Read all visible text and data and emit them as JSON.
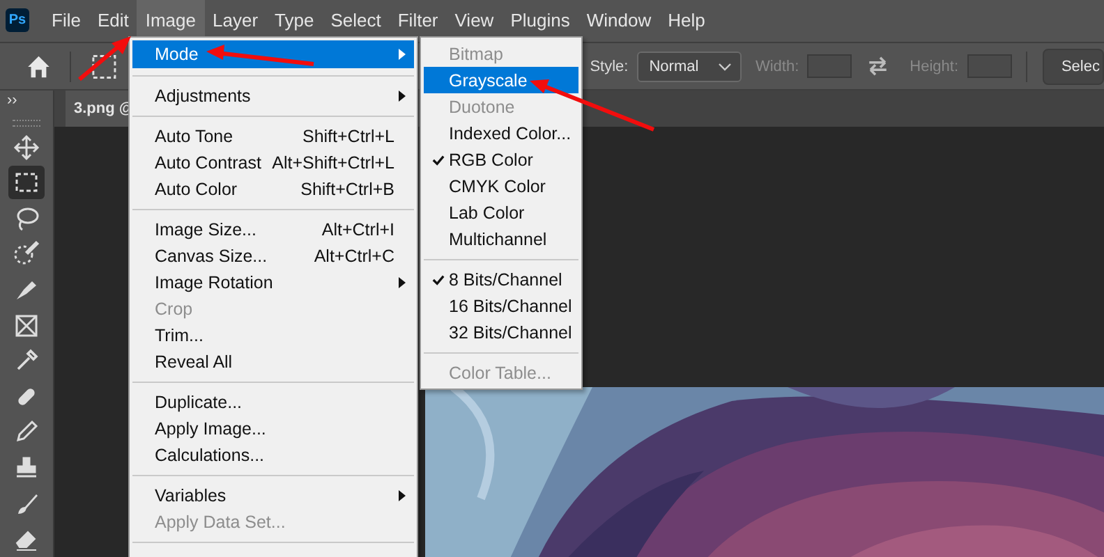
{
  "app_logo": "Ps",
  "menu_bar": [
    {
      "label": "File",
      "selected": false
    },
    {
      "label": "Edit",
      "selected": false
    },
    {
      "label": "Image",
      "selected": true
    },
    {
      "label": "Layer",
      "selected": false
    },
    {
      "label": "Type",
      "selected": false
    },
    {
      "label": "Select",
      "selected": false
    },
    {
      "label": "Filter",
      "selected": false
    },
    {
      "label": "View",
      "selected": false
    },
    {
      "label": "Plugins",
      "selected": false
    },
    {
      "label": "Window",
      "selected": false
    },
    {
      "label": "Help",
      "selected": false
    }
  ],
  "options_bar": {
    "style_label": "Style:",
    "style_value": "Normal",
    "width_label": "Width:",
    "height_label": "Height:",
    "width_disabled": true,
    "height_disabled": true,
    "button": "Selec"
  },
  "toolbar_toggle": "››",
  "tools": [
    {
      "kind": "move",
      "selected": false
    },
    {
      "kind": "marquee",
      "selected": true
    },
    {
      "kind": "lasso",
      "selected": false
    },
    {
      "kind": "quick-select",
      "selected": false
    },
    {
      "kind": "pen",
      "selected": false
    },
    {
      "kind": "frame",
      "selected": false
    },
    {
      "kind": "eyedropper",
      "selected": false
    },
    {
      "kind": "healing",
      "selected": false
    },
    {
      "kind": "pencil",
      "selected": false
    },
    {
      "kind": "stamp",
      "selected": false
    },
    {
      "kind": "brush",
      "selected": false
    },
    {
      "kind": "eraser",
      "selected": false
    }
  ],
  "document_tab": "3.png @",
  "image_menu": [
    {
      "kind": "item",
      "label": "Mode",
      "submenu": true,
      "selected": true,
      "disabled": false
    },
    {
      "kind": "separator"
    },
    {
      "kind": "item",
      "label": "Adjustments",
      "submenu": true,
      "selected": false,
      "disabled": false
    },
    {
      "kind": "separator"
    },
    {
      "kind": "item",
      "label": "Auto Tone",
      "shortcut": "Shift+Ctrl+L",
      "selected": false,
      "disabled": false
    },
    {
      "kind": "item",
      "label": "Auto Contrast",
      "shortcut": "Alt+Shift+Ctrl+L",
      "selected": false,
      "disabled": false
    },
    {
      "kind": "item",
      "label": "Auto Color",
      "shortcut": "Shift+Ctrl+B",
      "selected": false,
      "disabled": false
    },
    {
      "kind": "separator"
    },
    {
      "kind": "item",
      "label": "Image Size...",
      "shortcut": "Alt+Ctrl+I",
      "selected": false,
      "disabled": false
    },
    {
      "kind": "item",
      "label": "Canvas Size...",
      "shortcut": "Alt+Ctrl+C",
      "selected": false,
      "disabled": false
    },
    {
      "kind": "item",
      "label": "Image Rotation",
      "submenu": true,
      "selected": false,
      "disabled": false
    },
    {
      "kind": "item",
      "label": "Crop",
      "selected": false,
      "disabled": true
    },
    {
      "kind": "item",
      "label": "Trim...",
      "selected": false,
      "disabled": false
    },
    {
      "kind": "item",
      "label": "Reveal All",
      "selected": false,
      "disabled": false
    },
    {
      "kind": "separator"
    },
    {
      "kind": "item",
      "label": "Duplicate...",
      "selected": false,
      "disabled": false
    },
    {
      "kind": "item",
      "label": "Apply Image...",
      "selected": false,
      "disabled": false
    },
    {
      "kind": "item",
      "label": "Calculations...",
      "selected": false,
      "disabled": false
    },
    {
      "kind": "separator"
    },
    {
      "kind": "item",
      "label": "Variables",
      "submenu": true,
      "selected": false,
      "disabled": false
    },
    {
      "kind": "item",
      "label": "Apply Data Set...",
      "selected": false,
      "disabled": true
    },
    {
      "kind": "separator"
    }
  ],
  "mode_submenu": [
    {
      "kind": "item",
      "label": "Bitmap",
      "checked": false,
      "selected": false,
      "disabled": true
    },
    {
      "kind": "item",
      "label": "Grayscale",
      "checked": false,
      "selected": true,
      "disabled": false
    },
    {
      "kind": "item",
      "label": "Duotone",
      "checked": false,
      "selected": false,
      "disabled": true
    },
    {
      "kind": "item",
      "label": "Indexed Color...",
      "checked": false,
      "selected": false,
      "disabled": false
    },
    {
      "kind": "item",
      "label": "RGB Color",
      "checked": true,
      "selected": false,
      "disabled": false
    },
    {
      "kind": "item",
      "label": "CMYK Color",
      "checked": false,
      "selected": false,
      "disabled": false
    },
    {
      "kind": "item",
      "label": "Lab Color",
      "checked": false,
      "selected": false,
      "disabled": false
    },
    {
      "kind": "item",
      "label": "Multichannel",
      "checked": false,
      "selected": false,
      "disabled": false
    },
    {
      "kind": "separator"
    },
    {
      "kind": "item",
      "label": "8 Bits/Channel",
      "checked": true,
      "selected": false,
      "disabled": false
    },
    {
      "kind": "item",
      "label": "16 Bits/Channel",
      "checked": false,
      "selected": false,
      "disabled": false
    },
    {
      "kind": "item",
      "label": "32 Bits/Channel",
      "checked": false,
      "selected": false,
      "disabled": false
    },
    {
      "kind": "separator"
    },
    {
      "kind": "item",
      "label": "Color Table...",
      "checked": false,
      "selected": false,
      "disabled": true
    }
  ]
}
